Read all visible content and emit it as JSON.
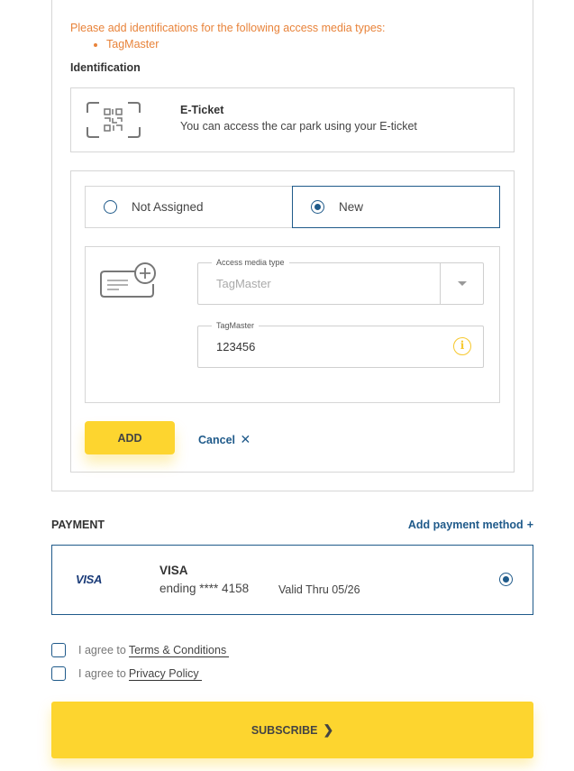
{
  "warning": {
    "message": "Please add identifications for the following access media types:",
    "items": [
      "TagMaster"
    ]
  },
  "identification": {
    "heading": "Identification",
    "eticket": {
      "icon": "qr-code-icon",
      "title": "E-Ticket",
      "description": "You can access the car park using your E-ticket"
    },
    "assignment_options": [
      {
        "label": "Not Assigned",
        "selected": false
      },
      {
        "label": "New",
        "selected": true
      }
    ],
    "form": {
      "icon": "card-add-icon",
      "access_media_type": {
        "label": "Access media type",
        "value": "TagMaster"
      },
      "tagmaster": {
        "label": "TagMaster",
        "value": "123456",
        "icon": "info-icon"
      }
    },
    "add_label": "ADD",
    "cancel_label": "Cancel",
    "cancel_icon": "✕"
  },
  "payment": {
    "heading": "PAYMENT",
    "add_label": "Add payment method",
    "add_icon": "+",
    "card": {
      "logo": "VISA",
      "brand": "VISA",
      "ending": "ending **** 4158",
      "valid": "Valid Thru 05/26",
      "selected": true
    }
  },
  "agreements": [
    {
      "prefix": "I agree to",
      "link": "Terms & Conditions",
      "checked": false
    },
    {
      "prefix": "I agree to",
      "link": "Privacy Policy",
      "checked": false
    }
  ],
  "subscribe": {
    "label": "SUBSCRIBE",
    "icon": "❯"
  },
  "colors": {
    "accent": "#fdd52f",
    "primary": "#1f5a8a",
    "warning": "#e8833a"
  }
}
